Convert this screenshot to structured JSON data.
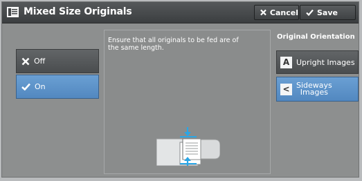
{
  "header": {
    "title": "Mixed Size Originals",
    "title_icon": "document-list-icon",
    "cancel_label": "Cancel",
    "save_label": "Save"
  },
  "options": {
    "off_label": "Off",
    "on_label": "On",
    "selected": "On"
  },
  "panel": {
    "message": "Ensure that all originals to be fed are of the same length.",
    "illustration": "document-feeder-illustration"
  },
  "orientation": {
    "title": "Original Orientation",
    "upright_label": "Upright Images",
    "sideways_label_line1": "Sideways",
    "sideways_label_line2": "Images",
    "selected": "Sideways Images"
  },
  "colors": {
    "accent": "#5b93ca",
    "titlebar": "#45484a",
    "arrow": "#2aa6e6"
  }
}
